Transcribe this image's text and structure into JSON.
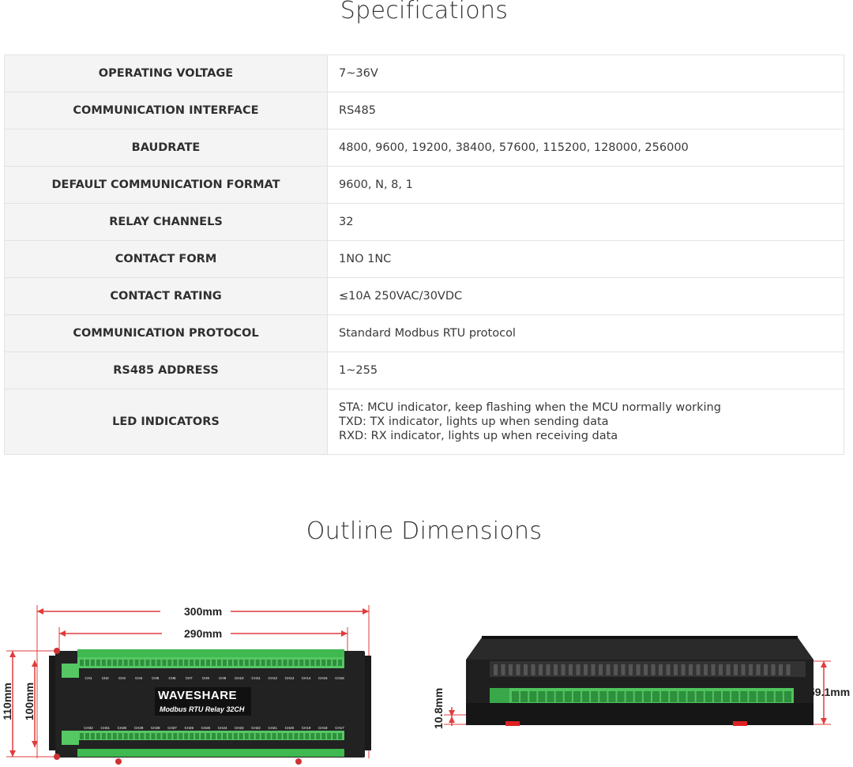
{
  "specifications": {
    "title": "Specifications",
    "rows": [
      {
        "key": "OPERATING VOLTAGE",
        "value": "7~36V"
      },
      {
        "key": "COMMUNICATION INTERFACE",
        "value": "RS485"
      },
      {
        "key": "BAUDRATE",
        "value": "4800, 9600, 19200, 38400, 57600, 115200, 128000, 256000"
      },
      {
        "key": "DEFAULT COMMUNICATION FORMAT",
        "value": "9600, N, 8, 1"
      },
      {
        "key": "RELAY CHANNELS",
        "value": "32"
      },
      {
        "key": "CONTACT FORM",
        "value": "1NO 1NC"
      },
      {
        "key": "CONTACT RATING",
        "value": "≤10A 250VAC/30VDC"
      },
      {
        "key": "COMMUNICATION PROTOCOL",
        "value": "Standard Modbus RTU protocol"
      },
      {
        "key": "RS485 ADDRESS",
        "value": "1~255"
      }
    ],
    "led": {
      "key": "LED INDICATORS",
      "lines": [
        "STA: MCU indicator, keep flashing when the MCU normally working",
        "TXD: TX indicator, lights up when sending data",
        "RXD: RX indicator, lights up when receiving data"
      ]
    }
  },
  "outline": {
    "title": "Outline Dimensions",
    "width_outer": "300mm",
    "width_inner": "290mm",
    "height_outer": "110mm",
    "height_inner": "100mm",
    "side_height": "59.1mm",
    "side_base": "10.8mm",
    "brand": "WAVESHARE",
    "product": "Modbus RTU Relay 32CH",
    "top_channels": [
      "CH1",
      "CH2",
      "CH3",
      "CH4",
      "CH5",
      "CH6",
      "CH7",
      "CH8",
      "CH9",
      "CH10",
      "CH11",
      "CH12",
      "CH13",
      "CH14",
      "CH15",
      "CH16"
    ],
    "bottom_channels": [
      "CH32",
      "CH31",
      "CH30",
      "CH29",
      "CH28",
      "CH27",
      "CH26",
      "CH25",
      "CH24",
      "CH23",
      "CH22",
      "CH21",
      "CH20",
      "CH19",
      "CH18",
      "CH17"
    ]
  },
  "colors": {
    "dimension_line": "#e03c3c",
    "terminal_green": "#3fb950",
    "housing": "#1d1d1d"
  }
}
